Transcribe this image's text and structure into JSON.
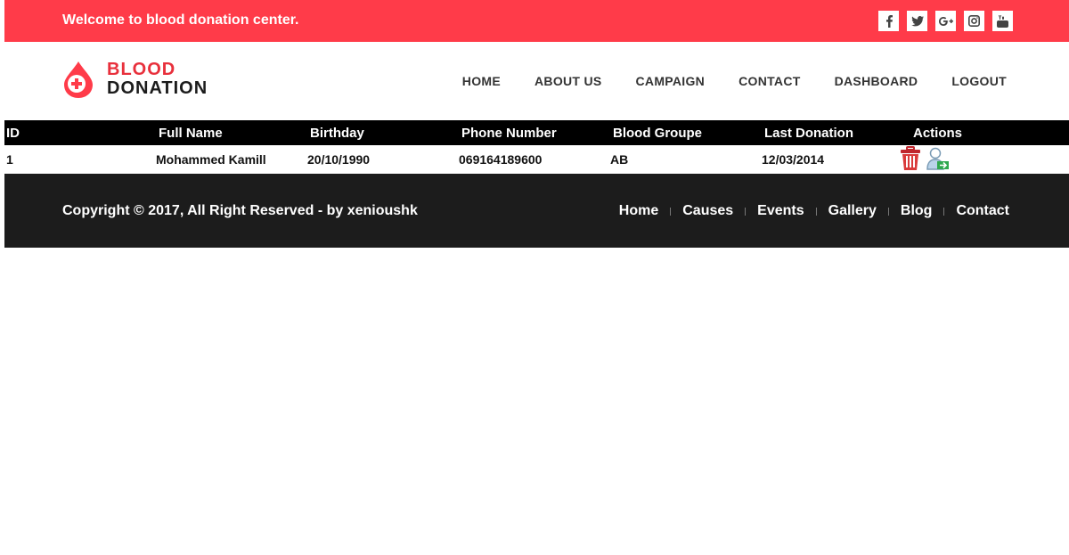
{
  "topbar": {
    "welcome": "Welcome to blood donation center.",
    "social": [
      {
        "label": "f",
        "icon": "facebook-icon"
      },
      {
        "label": "t",
        "icon": "twitter-icon"
      },
      {
        "label": "g+",
        "icon": "google-plus-icon"
      },
      {
        "label": "ig",
        "icon": "instagram-icon"
      },
      {
        "label": "yt",
        "icon": "youtube-icon"
      }
    ]
  },
  "logo": {
    "line1": "BLOOD",
    "line2": "DONATION"
  },
  "nav": [
    "HOME",
    "ABOUT US",
    "CAMPAIGN",
    "CONTACT",
    "DASHBOARD",
    "LOGOUT"
  ],
  "table": {
    "headers": [
      "ID",
      "Full Name",
      "Birthday",
      "Phone Number",
      "Blood Groupe",
      "Last Donation",
      "Actions"
    ],
    "rows": [
      {
        "id": "1",
        "name": "Mohammed Kamill",
        "birthday": "20/10/1990",
        "phone": "069164189600",
        "blood": "AB",
        "last": "12/03/2014"
      }
    ]
  },
  "footer": {
    "copyright": "Copyright © 2017, All Right Reserved - by xenioushk",
    "links": [
      "Home",
      "Causes",
      "Events",
      "Gallery",
      "Blog",
      "Contact"
    ]
  },
  "colors": {
    "accent": "#ff3b49",
    "footer": "#1c1c1c",
    "table_header": "#000000"
  }
}
